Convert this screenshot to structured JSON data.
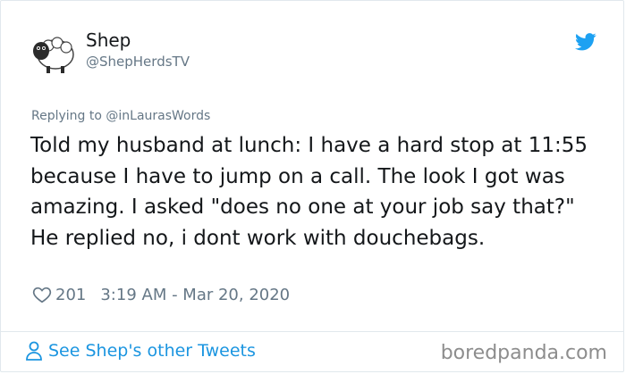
{
  "author": {
    "display_name": "Shep",
    "handle": "@ShepHerdsTV"
  },
  "reply": {
    "prefix": "Replying to ",
    "handle": "@inLaurasWords"
  },
  "tweet": {
    "text": "Told my husband at lunch: I have a hard stop at 11:55 because I have to jump on a call. The look I got was amazing. I asked \"does no one at your job say that?\" He replied no, i dont work with douchebags."
  },
  "meta": {
    "likes": "201",
    "timestamp": "3:19 AM - Mar 20, 2020"
  },
  "footer": {
    "link_label": "See Shep's other Tweets",
    "watermark": "boredpanda.com"
  },
  "icons": {
    "bird": "twitter-bird-icon",
    "heart": "heart-icon",
    "person": "person-icon"
  },
  "colors": {
    "twitter_blue": "#1da1f2",
    "link_blue": "#1b95e0",
    "muted": "#657786"
  }
}
